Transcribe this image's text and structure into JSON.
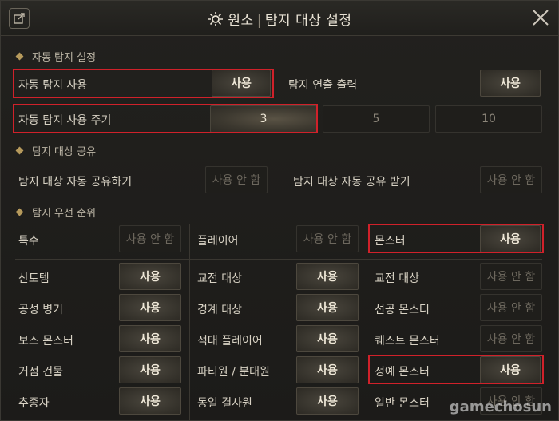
{
  "title": {
    "prefix": "원소",
    "main": "탐지 대상 설정"
  },
  "sections": {
    "auto": "자동 탐지 설정",
    "share": "탐지 대상 공유",
    "priority": "탐지 우선 순위"
  },
  "auto": {
    "use_label": "자동 탐지 사용",
    "use_value": "사용",
    "effect_label": "탐지 연출 출력",
    "effect_value": "사용",
    "cycle_label": "자동 탐지 사용 주기",
    "cycle_options": [
      "3",
      "5",
      "10"
    ],
    "cycle_selected": "3"
  },
  "share": {
    "send_label": "탐지 대상 자동 공유하기",
    "send_value": "사용 안 함",
    "recv_label": "탐지 대상 자동 공유 받기",
    "recv_value": "사용 안 함"
  },
  "priority": {
    "col1": [
      {
        "label": "특수",
        "value": "사용 안 함",
        "on": false
      },
      {
        "label": "산토템",
        "value": "사용",
        "on": true
      },
      {
        "label": "공성 병기",
        "value": "사용",
        "on": true
      },
      {
        "label": "보스 몬스터",
        "value": "사용",
        "on": true
      },
      {
        "label": "거점 건물",
        "value": "사용",
        "on": true
      },
      {
        "label": "추종자",
        "value": "사용",
        "on": true
      }
    ],
    "col2": [
      {
        "label": "플레이어",
        "value": "사용 안 함",
        "on": false
      },
      {
        "label": "교전 대상",
        "value": "사용",
        "on": true
      },
      {
        "label": "경계 대상",
        "value": "사용",
        "on": true
      },
      {
        "label": "적대 플레이어",
        "value": "사용",
        "on": true
      },
      {
        "label": "파티원 / 분대원",
        "value": "사용",
        "on": true
      },
      {
        "label": "동일 결사원",
        "value": "사용",
        "on": true
      }
    ],
    "col3": [
      {
        "label": "몬스터",
        "value": "사용",
        "on": true
      },
      {
        "label": "교전 대상",
        "value": "사용 안 함",
        "on": false
      },
      {
        "label": "선공 몬스터",
        "value": "사용 안 함",
        "on": false
      },
      {
        "label": "퀘스트 몬스터",
        "value": "사용 안 함",
        "on": false
      },
      {
        "label": "정예 몬스터",
        "value": "사용",
        "on": true
      },
      {
        "label": "일반 몬스터",
        "value": "사용 안 함",
        "on": false
      }
    ]
  },
  "watermark": "gamechosun",
  "colors": {
    "highlight": "#d0212a",
    "accent": "#b69a5c"
  }
}
